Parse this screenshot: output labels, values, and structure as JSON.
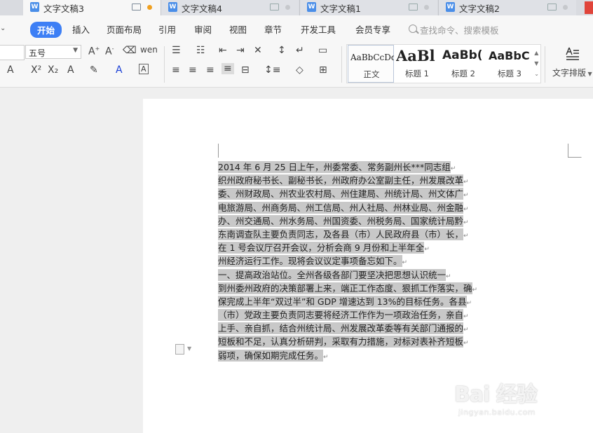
{
  "tabs": [
    {
      "label": "文字文稿3",
      "active": true
    },
    {
      "label": "文字文稿4",
      "active": false
    },
    {
      "label": "文字文稿1",
      "active": false
    },
    {
      "label": "文字文稿2",
      "active": false
    }
  ],
  "tab_icon_letter": "W",
  "menu": {
    "items": [
      "开始",
      "插入",
      "页面布局",
      "引用",
      "审阅",
      "视图",
      "章节",
      "开发工具",
      "会员专享"
    ],
    "active": "开始",
    "search_placeholder": "查找命令、搜索模板"
  },
  "ribbon": {
    "font_size_value": "五号",
    "styles": [
      {
        "sample": "AaBbCcDd",
        "name": "正文"
      },
      {
        "sample": "AaBl",
        "name": "标题 1"
      },
      {
        "sample": "AaBb(",
        "name": "标题 2"
      },
      {
        "sample": "AaBbC",
        "name": "标题 3"
      }
    ],
    "typeset_label": "文字排版"
  },
  "document": {
    "lines": [
      "2014 年 6 月 25 日上午，州委常委、常务副州长***同志组",
      "织州政府秘书长、副秘书长，州政府办公室副主任，州发展改革",
      "委、州财政局、州农业农村局、州住建局、州统计局、州文体广",
      "电旅游局、州商务局、州工信局、州人社局、州林业局、州金融",
      "办、州交通局、州水务局、州国资委、州税务局、国家统计局黔",
      "东南调查队主要负责同志，及各县（市）人民政府县（市）长，",
      "在 1 号会议厅召开会议，分析会商 9 月份和上半年全",
      "州经济运行工作。现将会议议定事项备忘如下。",
      "一、提高政治站位。全州各级各部门要坚决把思想认识统一",
      "到州委州政府的决策部署上来，端正工作态度、狠抓工作落实，确",
      "保完成上半年“双过半”和 GDP 增速达到 13%的目标任务。各县",
      "（市）党政主要负责同志要将经济工作作为一项政治任务，亲自",
      "上手、亲自抓，结合州统计局、州发展改革委等有关部门通报的",
      "短板和不足，认真分析研判，采取有力措施，对标对表补齐短板",
      "弱项，确保如期完成任务。"
    ]
  },
  "watermark": {
    "logo": "Bai 经验",
    "sub": "jingyan.baidu.com"
  },
  "colors": {
    "accent": "#3d7ff5",
    "tab_dot_active": "#f0a020",
    "selection_highlight": "#c8c8c8"
  }
}
